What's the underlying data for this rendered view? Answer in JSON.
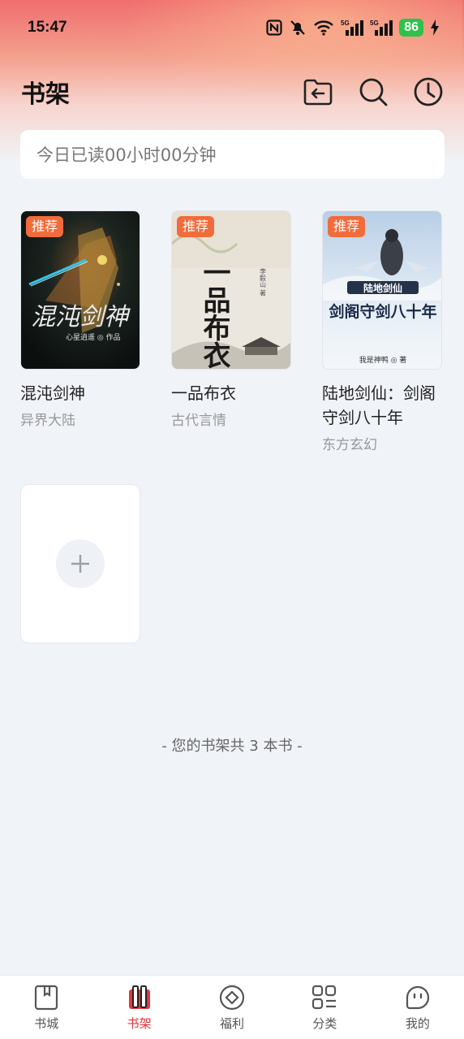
{
  "status_bar": {
    "time": "15:47",
    "battery": "86",
    "icons": [
      "nfc-icon",
      "mute-icon",
      "wifi-icon",
      "signal-5g-icon",
      "signal-5g-icon",
      "charging-icon"
    ]
  },
  "header": {
    "title": "书架",
    "actions": [
      "import-icon",
      "search-icon",
      "history-icon"
    ]
  },
  "reading_stats": {
    "text": "今日已读00小时00分钟"
  },
  "books": [
    {
      "title": "混沌剑神",
      "genre": "异界大陆",
      "tag": "推荐",
      "cover_text": "混沌剑神",
      "cover_author": "心星逍遥 ◎ 作品"
    },
    {
      "title": "一品布衣",
      "genre": "古代言情",
      "tag": "推荐",
      "cover_text": "一品布衣",
      "cover_author": "李毅山 著"
    },
    {
      "title": "陆地剑仙：剑阁守剑八十年",
      "genre": "东方玄幻",
      "tag": "推荐",
      "cover_text": "剑阁守剑八十年",
      "cover_author": "我是神鸭 ◎ 著",
      "cover_top": "陆地剑仙"
    }
  ],
  "add_book": {
    "icon": "plus-icon"
  },
  "shelf_count": "- 您的书架共 3 本书 -",
  "bottom_nav": [
    {
      "label": "书城",
      "icon": "bookstore-icon",
      "active": false
    },
    {
      "label": "书架",
      "icon": "bookshelf-icon",
      "active": true
    },
    {
      "label": "福利",
      "icon": "welfare-icon",
      "active": false
    },
    {
      "label": "分类",
      "icon": "category-icon",
      "active": false
    },
    {
      "label": "我的",
      "icon": "profile-icon",
      "active": false
    }
  ],
  "colors": {
    "accent": "#e8343c",
    "tag": "#f26b3a",
    "battery": "#2ec24a"
  }
}
